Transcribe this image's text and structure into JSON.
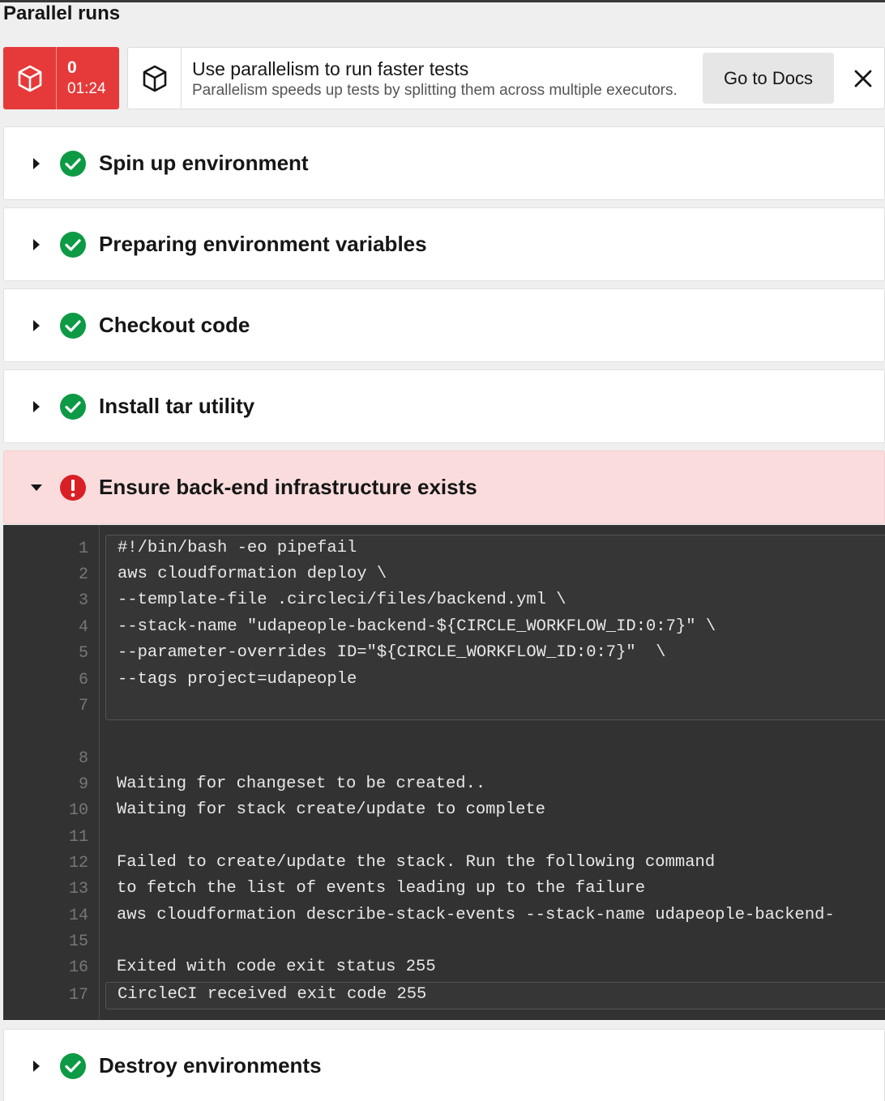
{
  "page": {
    "title": "Parallel runs"
  },
  "run_pill": {
    "index": "0",
    "duration": "01:24",
    "color": "#e63a3a"
  },
  "banner": {
    "title": "Use parallelism to run faster tests",
    "subtitle": "Parallelism speeds up tests by splitting them across multiple executors.",
    "docs_button": "Go to Docs",
    "close_icon": "close-icon"
  },
  "steps": [
    {
      "label": "Spin up environment",
      "status": "success"
    },
    {
      "label": "Preparing environment variables",
      "status": "success"
    },
    {
      "label": "Checkout code",
      "status": "success"
    },
    {
      "label": "Install tar utility",
      "status": "success"
    },
    {
      "label": "Ensure back-end infrastructure exists",
      "status": "failed",
      "expanded": true
    },
    {
      "label": "Destroy environments",
      "status": "success"
    }
  ],
  "log": {
    "line_numbers": [
      "1",
      "2",
      "3",
      "4",
      "5",
      "6",
      "7",
      "8",
      "9",
      "10",
      "11",
      "12",
      "13",
      "14",
      "15",
      "16",
      "17"
    ],
    "lines": [
      "#!/bin/bash -eo pipefail",
      "aws cloudformation deploy \\",
      "--template-file .circleci/files/backend.yml \\",
      "--stack-name \"udapeople-backend-${CIRCLE_WORKFLOW_ID:0:7}\" \\",
      "--parameter-overrides ID=\"${CIRCLE_WORKFLOW_ID:0:7}\"  \\",
      "--tags project=udapeople",
      "",
      "",
      "Waiting for changeset to be created..",
      "Waiting for stack create/update to complete",
      "",
      "Failed to create/update the stack. Run the following command",
      "to fetch the list of events leading up to the failure",
      "aws cloudformation describe-stack-events --stack-name udapeople-backend-",
      "",
      "Exited with code exit status 255",
      "CircleCI received exit code 255"
    ]
  },
  "colors": {
    "success": "#0d9a45",
    "failed": "#d81f26",
    "failed_bg": "#fadcdc",
    "log_bg": "#323232"
  }
}
